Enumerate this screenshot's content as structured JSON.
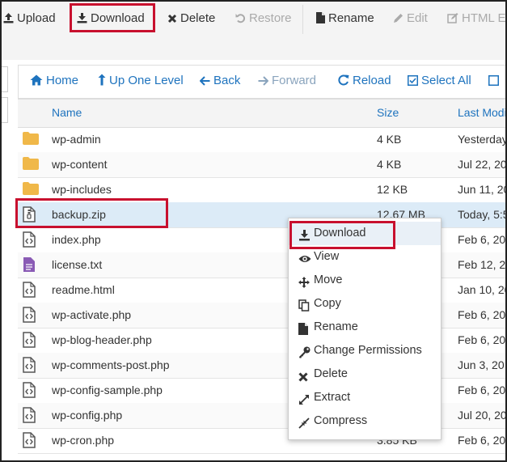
{
  "toolbar": {
    "upload": "Upload",
    "download": "Download",
    "delete": "Delete",
    "restore": "Restore",
    "rename": "Rename",
    "edit": "Edit",
    "html_editor": "HTML Ed"
  },
  "nav": {
    "home": "Home",
    "up_one_level": "Up One Level",
    "back": "Back",
    "forward": "Forward",
    "reload": "Reload",
    "select_all": "Select All"
  },
  "table": {
    "headers": {
      "name": "Name",
      "size": "Size",
      "last_modified": "Last Modi"
    },
    "rows": [
      {
        "name": "wp-admin",
        "size": "4 KB",
        "modified": "Yesterday",
        "type": "folder"
      },
      {
        "name": "wp-content",
        "size": "4 KB",
        "modified": "Jul 22, 20",
        "type": "folder"
      },
      {
        "name": "wp-includes",
        "size": "12 KB",
        "modified": "Jun 11, 20",
        "type": "folder"
      },
      {
        "name": "backup.zip",
        "size": "12.67 MB",
        "modified": "Today, 5:5",
        "type": "zip"
      },
      {
        "name": "index.php",
        "size": "",
        "modified": "Feb 6, 20",
        "type": "code"
      },
      {
        "name": "license.txt",
        "size": "",
        "modified": "Feb 12, 20",
        "type": "text"
      },
      {
        "name": "readme.html",
        "size": "",
        "modified": "Jan 10, 20",
        "type": "code"
      },
      {
        "name": "wp-activate.php",
        "size": "",
        "modified": "Feb 6, 20",
        "type": "code"
      },
      {
        "name": "wp-blog-header.php",
        "size": "",
        "modified": "Feb 6, 20",
        "type": "code"
      },
      {
        "name": "wp-comments-post.php",
        "size": "",
        "modified": "Jun 3, 20",
        "type": "code"
      },
      {
        "name": "wp-config-sample.php",
        "size": "",
        "modified": "Feb 6, 20",
        "type": "code"
      },
      {
        "name": "wp-config.php",
        "size": "",
        "modified": "Jul 20, 20",
        "type": "code"
      },
      {
        "name": "wp-cron.php",
        "size": "3.85 KB",
        "modified": "Feb 6, 20",
        "type": "code"
      }
    ]
  },
  "context_menu": {
    "items": [
      {
        "label": "Download",
        "icon": "download-icon"
      },
      {
        "label": "View",
        "icon": "eye-icon"
      },
      {
        "label": "Move",
        "icon": "move-icon"
      },
      {
        "label": "Copy",
        "icon": "copy-icon"
      },
      {
        "label": "Rename",
        "icon": "file-icon"
      },
      {
        "label": "Change Permissions",
        "icon": "key-icon"
      },
      {
        "label": "Delete",
        "icon": "close-icon"
      },
      {
        "label": "Extract",
        "icon": "expand-icon"
      },
      {
        "label": "Compress",
        "icon": "compress-icon"
      }
    ]
  },
  "colors": {
    "link": "#1e73be",
    "highlight": "#c8102e",
    "folder": "#f0b849",
    "selected_row": "#dcebf7"
  }
}
